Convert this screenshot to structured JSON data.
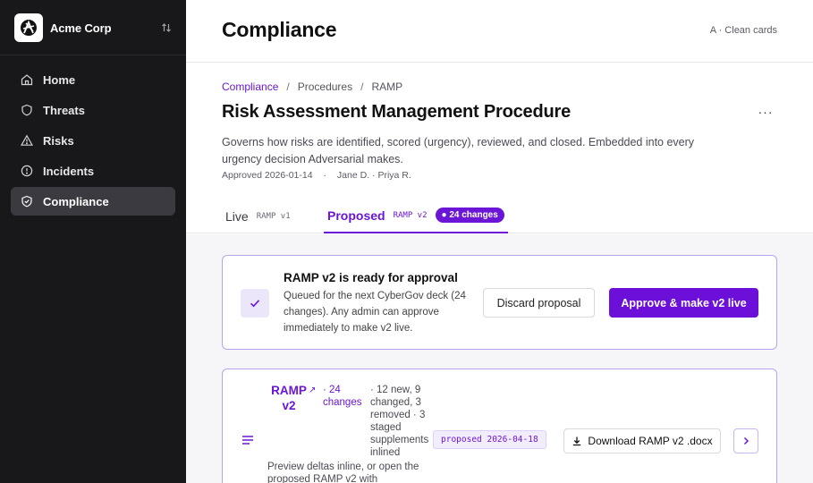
{
  "org": {
    "name": "Acme Corp",
    "logo_icon": "acme-logo-icon",
    "switch_icon": "sort-switch-icon"
  },
  "nav": {
    "items": [
      {
        "label": "Home",
        "icon": "home-icon",
        "active": false
      },
      {
        "label": "Threats",
        "icon": "shield-icon",
        "active": false
      },
      {
        "label": "Risks",
        "icon": "warning-triangle-icon",
        "active": false
      },
      {
        "label": "Incidents",
        "icon": "alert-circle-icon",
        "active": false
      },
      {
        "label": "Compliance",
        "icon": "shield-check-icon",
        "active": true
      }
    ]
  },
  "header": {
    "title": "Compliance",
    "variant": "A · Clean cards"
  },
  "breadcrumb": {
    "root": "Compliance",
    "section": "Procedures",
    "current": "RAMP",
    "separator": "/"
  },
  "document": {
    "title": "Risk Assessment Management Procedure",
    "description": "Governs how risks are identified, scored (urgency), reviewed, and closed. Embedded into every urgency decision Adversarial makes.",
    "approved": "Approved 2026-01-14",
    "dot": "·",
    "approvers": "Jane D. · Priya R.",
    "more": "···"
  },
  "tabs": {
    "live": {
      "label": "Live",
      "version": "RAMP v1"
    },
    "proposed": {
      "label": "Proposed",
      "version": "RAMP v2",
      "badge": "● 24 changes"
    }
  },
  "approval": {
    "title": "RAMP v2 is ready for approval",
    "text": "Queued for the next CyberGov deck (24 changes). Any admin can approve immediately to make v2 live.",
    "discard_label": "Discard proposal",
    "approve_label": "Approve & make v2 live"
  },
  "doc_card": {
    "name": "RAMP v2",
    "ext": "↗",
    "changes": "· 24 changes",
    "summary": "· 12 new, 9 changed, 3 removed · 3 staged supplements inlined",
    "preview": "Preview deltas inline, or open the proposed RAMP v2 with",
    "chip": "proposed 2026-04-18",
    "download_label": "Download RAMP v2 .docx"
  },
  "colors": {
    "accent": "#6b16d6",
    "sidebar": "#18181b",
    "active_nav": "#3a3a40"
  }
}
